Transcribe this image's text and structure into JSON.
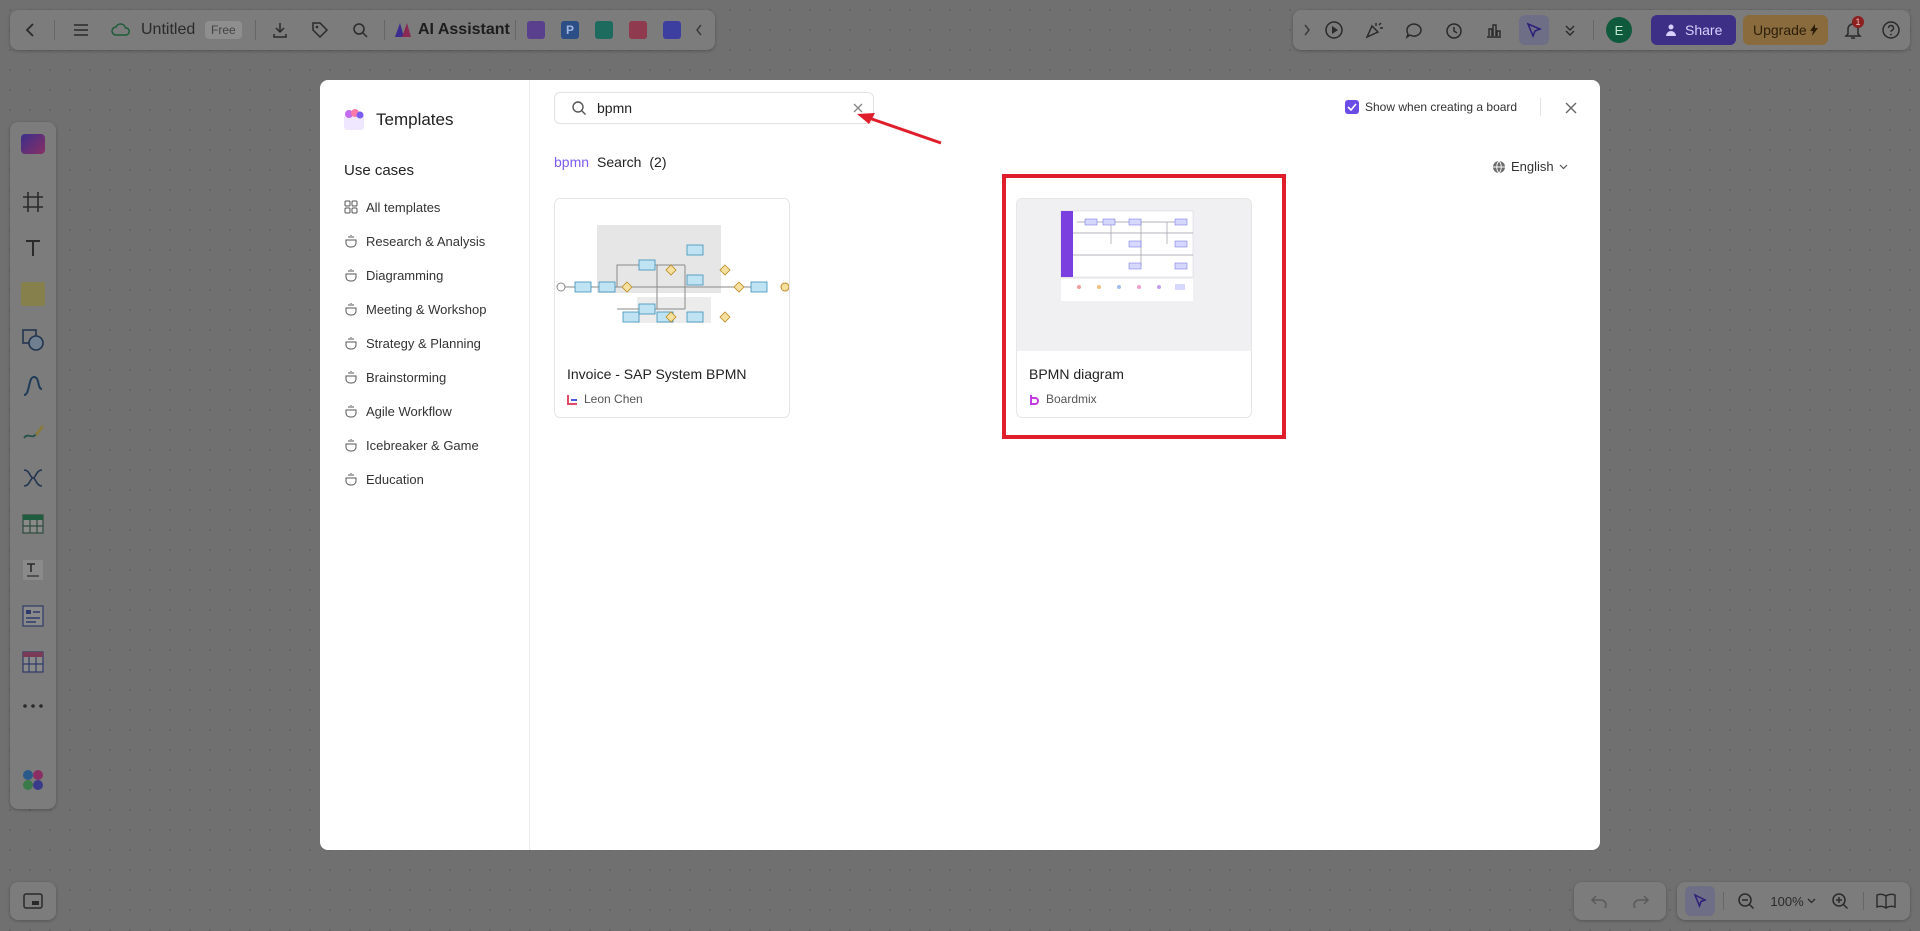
{
  "toolbar_left": {
    "doc_title": "Untitled",
    "plan_badge": "Free",
    "ai_label": "AI Assistant"
  },
  "toolbar_right": {
    "avatar_initial": "E",
    "share_label": "Share",
    "upgrade_label": "Upgrade",
    "notification_count": "1"
  },
  "zoom": {
    "level": "100%"
  },
  "modal": {
    "title": "Templates",
    "use_cases_heading": "Use cases",
    "categories": [
      "All templates",
      "Research & Analysis",
      "Diagramming",
      "Meeting & Workshop",
      "Strategy & Planning",
      "Brainstorming",
      "Agile Workflow",
      "Icebreaker & Game",
      "Education"
    ],
    "search": {
      "value": "bpmn"
    },
    "show_when_creating": {
      "label": "Show when creating a board",
      "checked": true
    },
    "results": {
      "keyword": "bpmn",
      "label": "Search",
      "count": "(2)"
    },
    "language": "English",
    "templates": [
      {
        "name": "Invoice - SAP System BPMN",
        "author": "Leon Chen"
      },
      {
        "name": "BPMN diagram",
        "author": "Boardmix"
      }
    ]
  },
  "colors": {
    "accent": "#6b4ce6",
    "highlight": "#e01e2b",
    "overlay": "#707070"
  }
}
